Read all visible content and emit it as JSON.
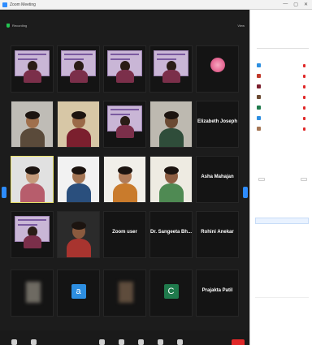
{
  "window": {
    "title": "Zoom Meeting",
    "controls": [
      "—",
      "▢",
      "✕"
    ]
  },
  "meeting": {
    "info_label": "Recording",
    "view_label": "View",
    "rows": [
      [
        {
          "name": "",
          "kind": "poster"
        },
        {
          "name": "",
          "kind": "poster"
        },
        {
          "name": "",
          "kind": "poster"
        },
        {
          "name": "",
          "kind": "poster"
        },
        {
          "name": "",
          "kind": "flower"
        }
      ],
      [
        {
          "name": "",
          "kind": "person",
          "skin": "#a0704d",
          "shirt": "#5a4a3a",
          "bg": "#bfbcb6"
        },
        {
          "name": "",
          "kind": "person",
          "skin": "#9b6a48",
          "shirt": "#7b1f2e",
          "bg": "#d7c7a6"
        },
        {
          "name": "",
          "kind": "poster"
        },
        {
          "name": "",
          "kind": "person",
          "skin": "#6b4a33",
          "shirt": "#2f4d3a",
          "bg": "#bdb9b0"
        },
        {
          "name": "",
          "kind": "label",
          "label": "Elizabeth Joseph"
        }
      ],
      [
        {
          "name": "",
          "kind": "person",
          "skin": "#c49a7a",
          "shirt": "#b75d6c",
          "bg": "#e1e1e1",
          "active": true
        },
        {
          "name": "",
          "kind": "person",
          "skin": "#a47554",
          "shirt": "#2a4f7d",
          "bg": "#f2f2f2"
        },
        {
          "name": "",
          "kind": "person",
          "skin": "#b07c59",
          "shirt": "#c97b2c",
          "bg": "#f1efe9"
        },
        {
          "name": "",
          "kind": "person",
          "skin": "#8e5e42",
          "shirt": "#4f8a53",
          "bg": "#eeebe2"
        },
        {
          "name": "",
          "kind": "label",
          "label": "Asha Mahajan"
        }
      ],
      [
        {
          "name": "",
          "kind": "poster"
        },
        {
          "name": "",
          "kind": "person",
          "skin": "#8a5a3e",
          "shirt": "#a8342f",
          "bg": "#2b2b2b"
        },
        {
          "name": "",
          "kind": "label",
          "label": "Zoom user"
        },
        {
          "name": "",
          "kind": "label",
          "label": "Dr. Sangeeta Bh..."
        },
        {
          "name": "",
          "kind": "label",
          "label": "Rohini Anekar"
        }
      ],
      [
        {
          "name": "",
          "kind": "blur",
          "bg": "#6e6a62"
        },
        {
          "name": "",
          "kind": "avatar",
          "letter": "a",
          "color": "#2d8ee0"
        },
        {
          "name": "",
          "kind": "blur",
          "bg": "#5e4c3c"
        },
        {
          "name": "",
          "kind": "avatar",
          "letter": "C",
          "color": "#1f7a4c"
        },
        {
          "name": "",
          "kind": "label",
          "label": "Prajakta Patil"
        }
      ]
    ]
  },
  "toolbar": {
    "left": [
      {
        "label": "",
        "icon": "microphone-icon"
      },
      {
        "label": "",
        "icon": "video-camera-icon"
      }
    ],
    "center": [
      {
        "label": "",
        "icon": "participants-icon"
      },
      {
        "label": "",
        "icon": "chat-icon"
      },
      {
        "label": "",
        "icon": "share-screen-icon"
      },
      {
        "label": "",
        "icon": "record-icon"
      },
      {
        "label": "",
        "icon": "reactions-icon"
      }
    ],
    "end_label": ""
  },
  "panel": {
    "title": "",
    "search_placeholder": "",
    "participants": [
      {
        "name": "",
        "avatar_color": "#2d8ee0"
      },
      {
        "name": "",
        "avatar_color": "#c0392b"
      },
      {
        "name": "",
        "avatar_color": "#7b1f2e"
      },
      {
        "name": "",
        "avatar_color": "#6b4a33"
      },
      {
        "name": "",
        "avatar_color": "#1f7a4c"
      },
      {
        "name": "",
        "avatar_color": "#2d8ee0"
      },
      {
        "name": "",
        "avatar_color": "#a47554"
      }
    ],
    "buttons": [
      "",
      ""
    ],
    "chat_title": "",
    "chat_from": "",
    "chat_text": "",
    "chat_input_placeholder": "",
    "chat_to": "",
    "chat_file": ""
  },
  "colors": {
    "accent": "#2d8cff",
    "end": "#e02828",
    "active_border": "#e8e06a"
  }
}
